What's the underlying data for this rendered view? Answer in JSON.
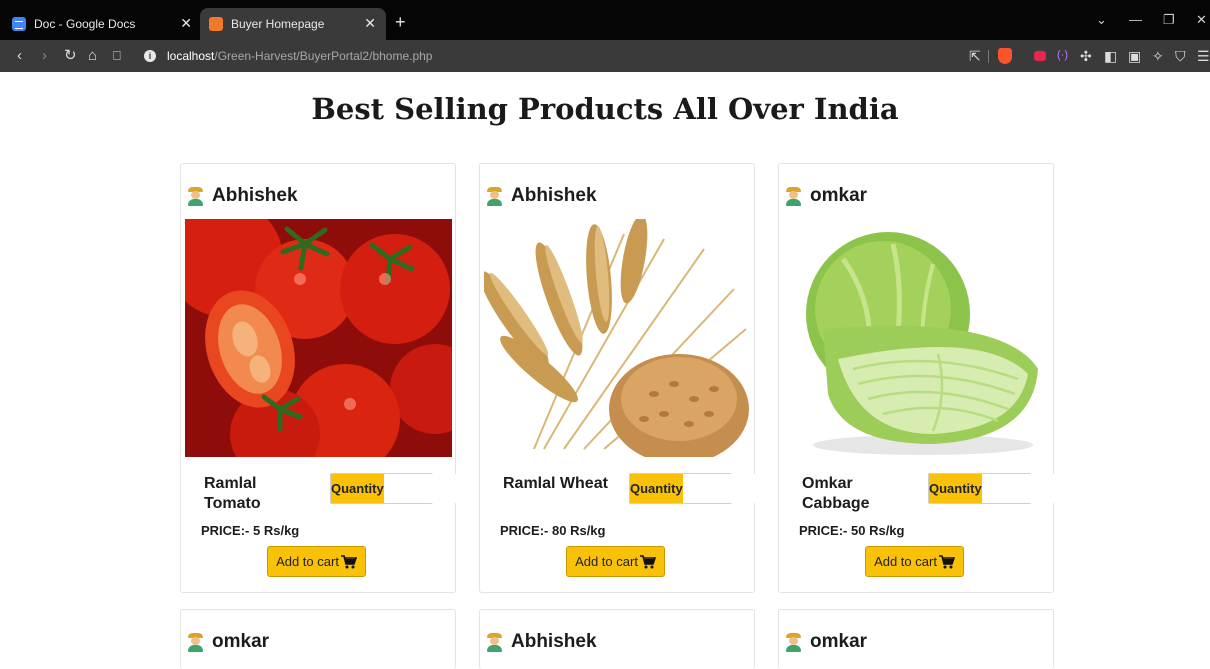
{
  "browser": {
    "tabs": [
      {
        "title": "Doc - Google Docs",
        "icon": "google-docs-icon"
      },
      {
        "title": "Buyer Homepage",
        "icon": "buyer-page-icon",
        "active": true
      }
    ],
    "url_host": "localhost",
    "url_path": "/Green-Harvest/BuyerPortal2/bhome.php"
  },
  "page": {
    "title": "Best Selling Products All Over India"
  },
  "labels": {
    "quantity": "Quantity",
    "add_to_cart": "Add to cart"
  },
  "products": [
    {
      "seller": "Abhishek",
      "name": "Ramlal Tomato",
      "price": "PRICE:- 5 Rs/kg",
      "image": "tomato-image"
    },
    {
      "seller": "Abhishek",
      "name": "Ramlal Wheat",
      "price": "PRICE:- 80 Rs/kg",
      "image": "wheat-image"
    },
    {
      "seller": "omkar",
      "name": "Omkar Cabbage",
      "price": "PRICE:- 50 Rs/kg",
      "image": "cabbage-image"
    }
  ],
  "next_row_sellers": [
    "omkar",
    "Abhishek",
    "omkar"
  ],
  "colors": {
    "accent": "#f9c108",
    "tab_bar": "#050505",
    "toolbar": "#3a3a3a"
  }
}
